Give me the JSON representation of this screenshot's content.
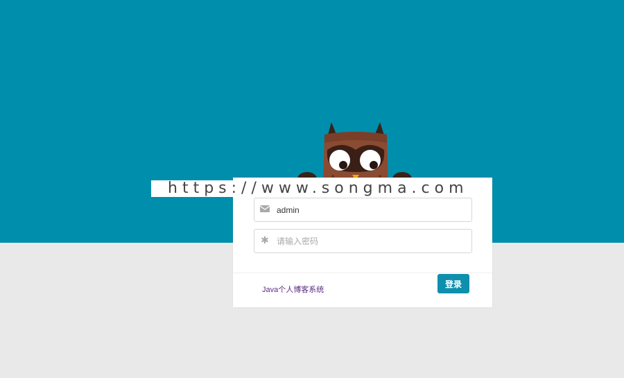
{
  "colors": {
    "background_top": "#008ead",
    "background_bottom": "#e9e9e9",
    "card": "#ffffff",
    "button": "#0e8fad",
    "link": "#5b2c83"
  },
  "watermark": "https://www.songma.com",
  "login": {
    "username": {
      "icon": "envelope-icon",
      "value": "admin"
    },
    "password": {
      "icon": "asterisk-icon",
      "placeholder": "请输入密码"
    },
    "submit_label": "登录",
    "footer_link": "Java个人博客系统"
  }
}
